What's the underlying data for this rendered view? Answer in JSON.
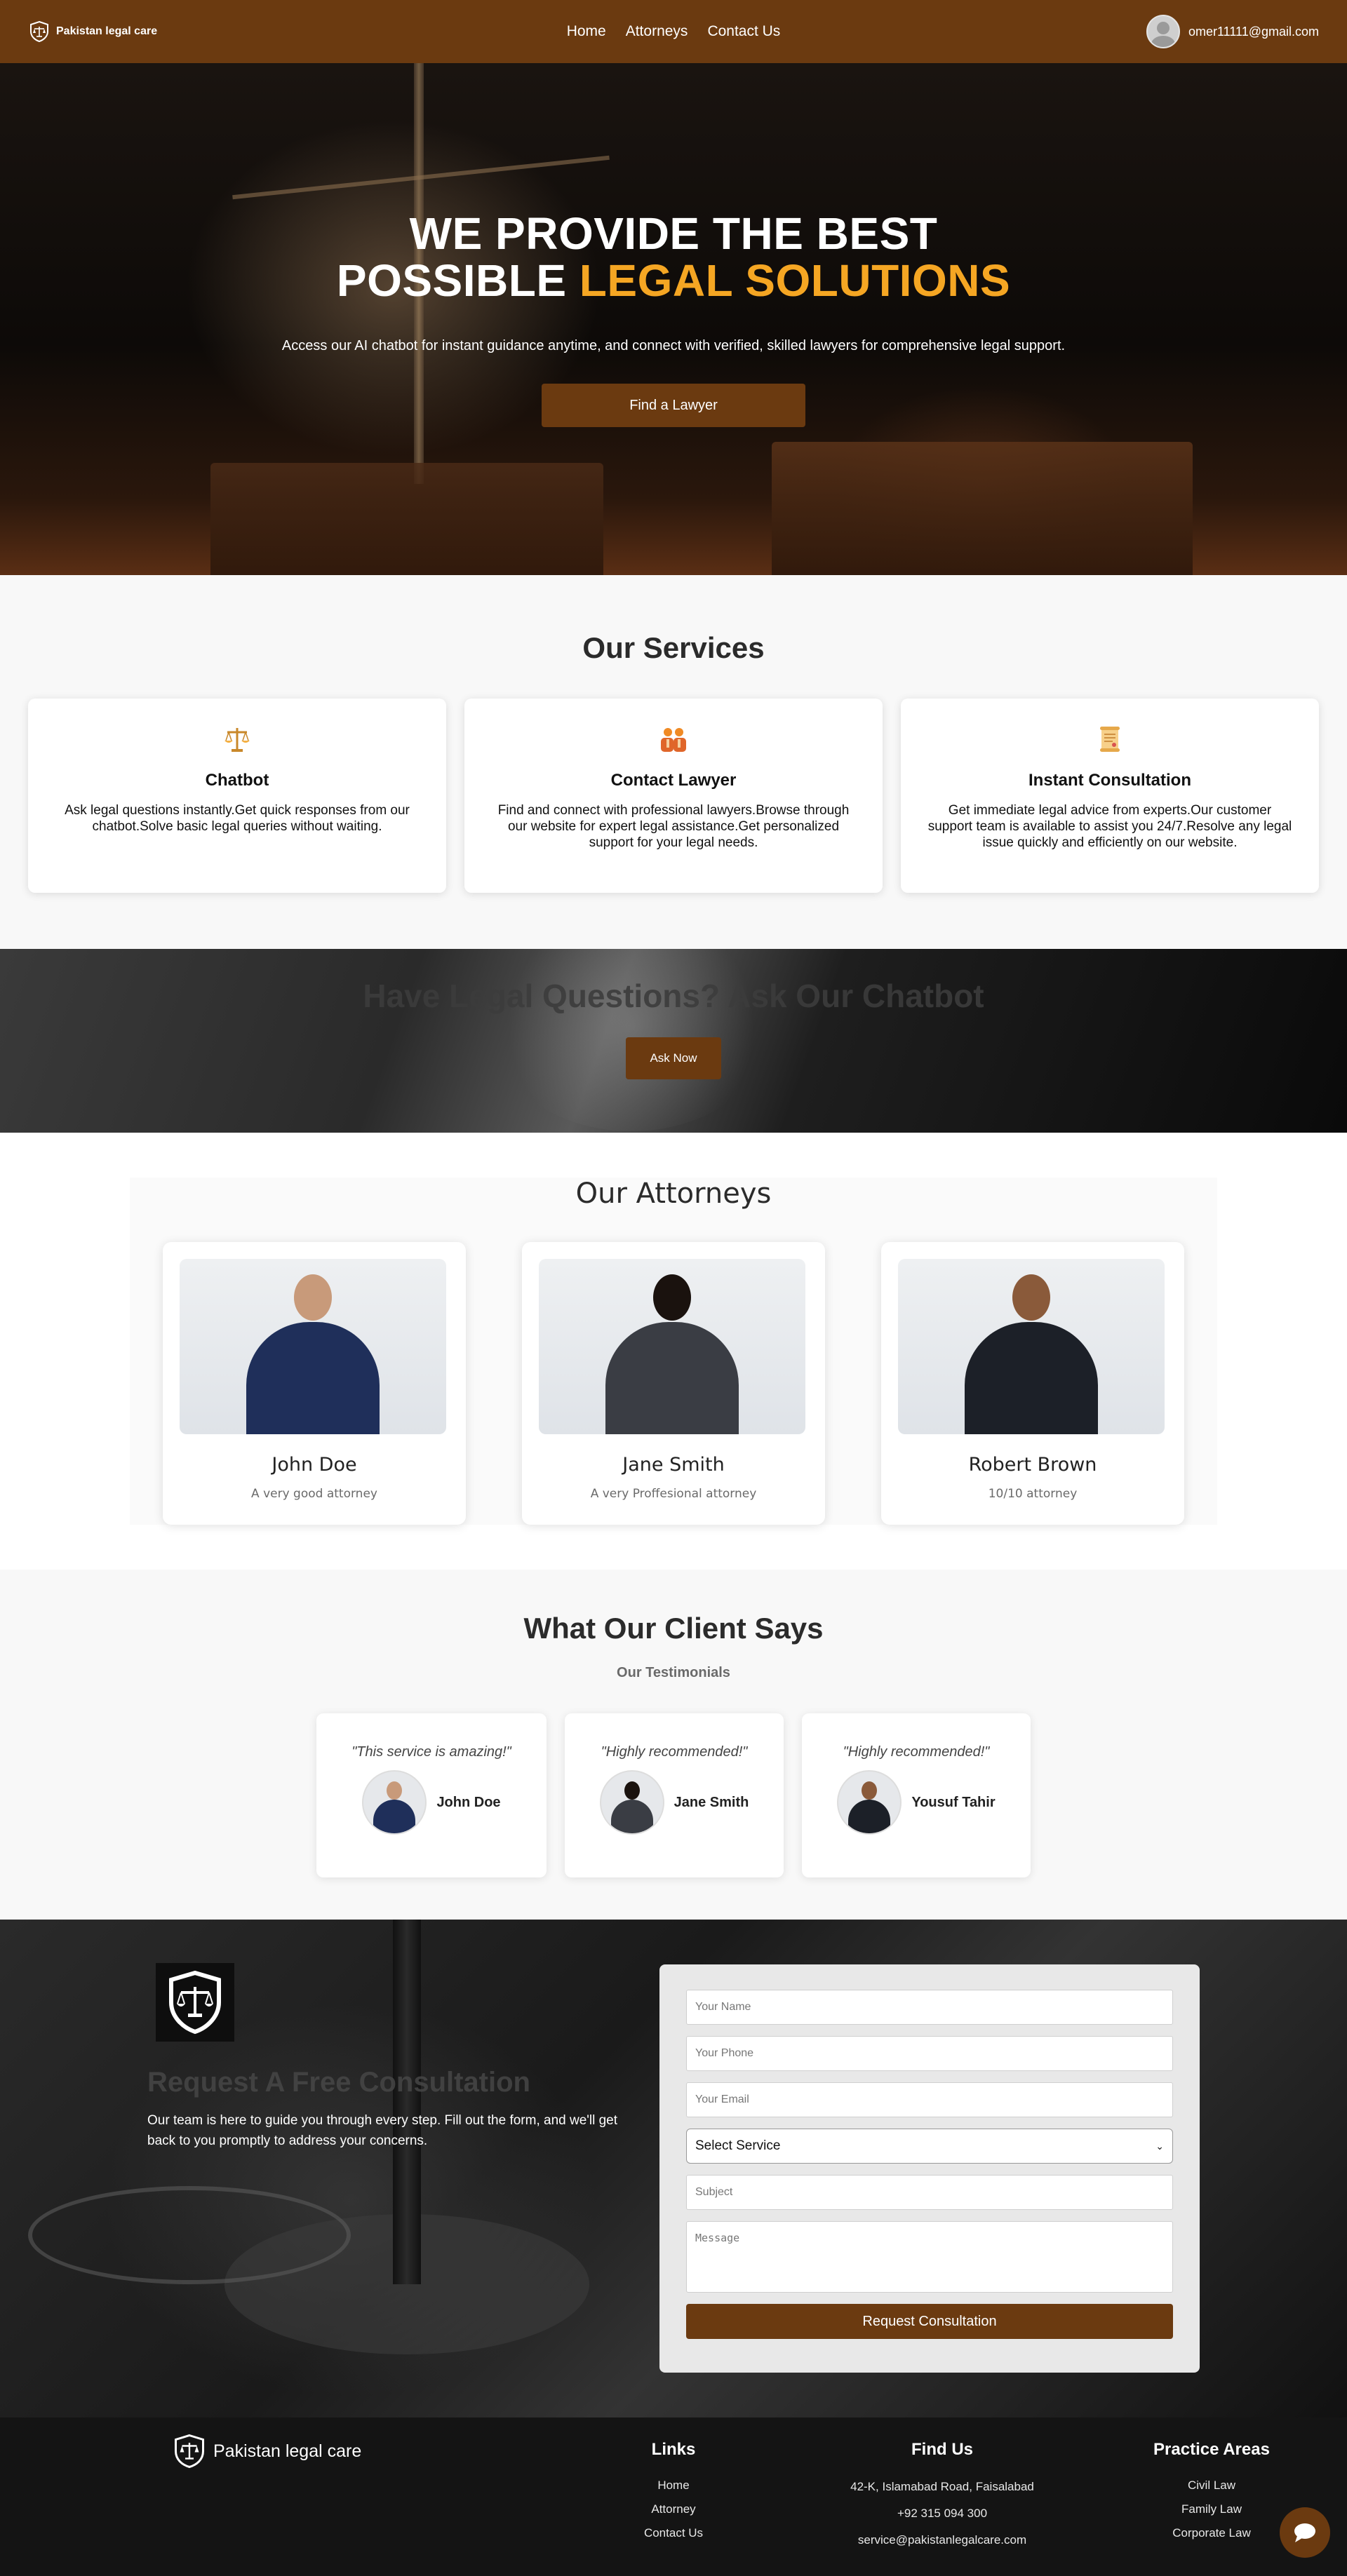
{
  "nav": {
    "brand": "Pakistan legal care",
    "links": [
      "Home",
      "Attorneys",
      "Contact Us"
    ],
    "user_email": "omer11111@gmail.com"
  },
  "hero": {
    "title_line1": "WE PROVIDE THE BEST",
    "title_line2_plain": "POSSIBLE ",
    "title_line2_accent": "LEGAL SOLUTIONS",
    "subtitle": "Access our AI chatbot for instant guidance anytime, and connect with verified, skilled lawyers for comprehensive legal support.",
    "cta": "Find a Lawyer"
  },
  "services": {
    "title": "Our Services",
    "items": [
      {
        "icon": "scales-icon",
        "title": "Chatbot",
        "desc": "Ask legal questions instantly.Get quick responses from our chatbot.Solve basic legal queries without waiting."
      },
      {
        "icon": "people-icon",
        "title": "Contact Lawyer",
        "desc": "Find and connect with professional lawyers.Browse through our website for expert legal assistance.Get personalized support for your legal needs."
      },
      {
        "icon": "scroll-icon",
        "title": "Instant Consultation",
        "desc": "Get immediate legal advice from experts.Our customer support team is available to assist you 24/7.Resolve any legal issue quickly and efficiently on our website."
      }
    ]
  },
  "chatbot_banner": {
    "title": "Have Legal Questions? Ask Our Chatbot",
    "cta": "Ask Now"
  },
  "attorneys": {
    "title": "Our Attorneys",
    "items": [
      {
        "name": "John Doe",
        "desc": "A very good attorney",
        "suit": "#1f2f5a"
      },
      {
        "name": "Jane Smith",
        "desc": "A very Proffesional attorney",
        "suit": "#3a3d44"
      },
      {
        "name": "Robert Brown",
        "desc": "10/10 attorney",
        "suit": "#1c2028"
      }
    ]
  },
  "testimonials": {
    "title": "What Our Client Says",
    "subtitle": "Our Testimonials",
    "items": [
      {
        "quote": "\"This service is amazing!\"",
        "name": "John Doe",
        "suit": "#1f2f5a"
      },
      {
        "quote": "\"Highly recommended!\"",
        "name": "Jane Smith",
        "suit": "#3a3d44"
      },
      {
        "quote": "\"Highly recommended!\"",
        "name": "Yousuf Tahir",
        "suit": "#1c2028"
      }
    ]
  },
  "consultation": {
    "title": "Request A Free Consultation",
    "text": "Our team is here to guide you through every step. Fill out the form, and we'll get back to you promptly to address your concerns.",
    "form": {
      "name_placeholder": "Your Name",
      "phone_placeholder": "Your Phone",
      "email_placeholder": "Your Email",
      "service_selected": "Select Service",
      "subject_placeholder": "Subject",
      "message_placeholder": "Message",
      "submit": "Request Consultation"
    }
  },
  "footer": {
    "brand": "Pakistan legal care",
    "links_title": "Links",
    "links": [
      "Home",
      "Attorney",
      "Contact Us"
    ],
    "find_title": "Find Us",
    "find": [
      "42-K, Islamabad Road, Faisalabad",
      "+92 315 094 300",
      "service@pakistanlegalcare.com"
    ],
    "practice_title": "Practice Areas",
    "practice": [
      "Civil Law",
      "Family Law",
      "Corporate Law"
    ]
  },
  "colors": {
    "brand_brown": "#6b3a10",
    "accent_gold": "#f5a623"
  }
}
